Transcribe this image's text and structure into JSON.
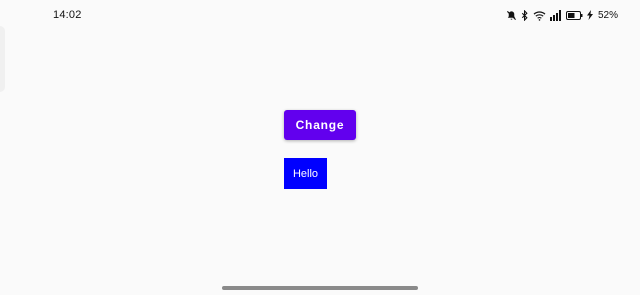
{
  "status_bar": {
    "time": "14:02",
    "battery_percent": "52%",
    "icons": [
      "mute-icon",
      "bluetooth-icon",
      "wifi-icon",
      "signal-icon",
      "battery-icon",
      "charging-icon"
    ]
  },
  "main": {
    "change_button_label": "Change",
    "hello_label": "Hello"
  },
  "colors": {
    "background": "#fafafa",
    "button": "#6200ee",
    "label_bg": "#0000ff",
    "text_light": "#ffffff"
  }
}
